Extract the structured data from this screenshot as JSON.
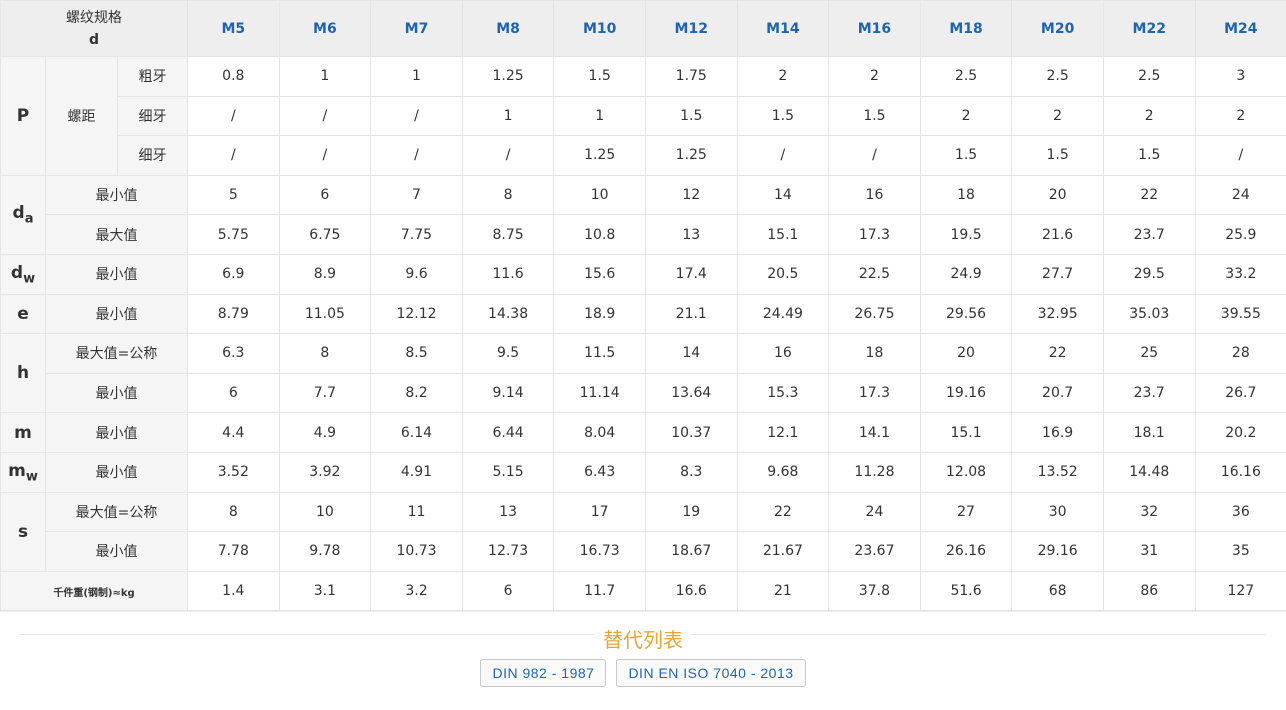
{
  "header": {
    "corner_line1": "螺纹规格",
    "corner_line2": "d",
    "sizes": [
      "M5",
      "M6",
      "M7",
      "M8",
      "M10",
      "M12",
      "M14",
      "M16",
      "M18",
      "M20",
      "M22",
      "M24"
    ]
  },
  "rows": {
    "P": {
      "symbol": "P",
      "group_label": "螺距",
      "coarse": {
        "label": "粗牙",
        "values": [
          "0.8",
          "1",
          "1",
          "1.25",
          "1.5",
          "1.75",
          "2",
          "2",
          "2.5",
          "2.5",
          "2.5",
          "3"
        ]
      },
      "fine1": {
        "label": "细牙",
        "values": [
          "/",
          "/",
          "/",
          "1",
          "1",
          "1.5",
          "1.5",
          "1.5",
          "2",
          "2",
          "2",
          "2"
        ]
      },
      "fine2": {
        "label": "细牙",
        "values": [
          "/",
          "/",
          "/",
          "/",
          "1.25",
          "1.25",
          "/",
          "/",
          "1.5",
          "1.5",
          "1.5",
          "/"
        ]
      }
    },
    "da": {
      "symbol": "d",
      "sub": "a",
      "min": {
        "label": "最小值",
        "values": [
          "5",
          "6",
          "7",
          "8",
          "10",
          "12",
          "14",
          "16",
          "18",
          "20",
          "22",
          "24"
        ]
      },
      "max": {
        "label": "最大值",
        "values": [
          "5.75",
          "6.75",
          "7.75",
          "8.75",
          "10.8",
          "13",
          "15.1",
          "17.3",
          "19.5",
          "21.6",
          "23.7",
          "25.9"
        ]
      }
    },
    "dw": {
      "symbol": "d",
      "sub": "w",
      "min": {
        "label": "最小值",
        "values": [
          "6.9",
          "8.9",
          "9.6",
          "11.6",
          "15.6",
          "17.4",
          "20.5",
          "22.5",
          "24.9",
          "27.7",
          "29.5",
          "33.2"
        ]
      }
    },
    "e": {
      "symbol": "e",
      "min": {
        "label": "最小值",
        "values": [
          "8.79",
          "11.05",
          "12.12",
          "14.38",
          "18.9",
          "21.1",
          "24.49",
          "26.75",
          "29.56",
          "32.95",
          "35.03",
          "39.55"
        ]
      }
    },
    "h": {
      "symbol": "h",
      "max": {
        "label": "最大值=公称",
        "values": [
          "6.3",
          "8",
          "8.5",
          "9.5",
          "11.5",
          "14",
          "16",
          "18",
          "20",
          "22",
          "25",
          "28"
        ]
      },
      "min": {
        "label": "最小值",
        "values": [
          "6",
          "7.7",
          "8.2",
          "9.14",
          "11.14",
          "13.64",
          "15.3",
          "17.3",
          "19.16",
          "20.7",
          "23.7",
          "26.7"
        ]
      }
    },
    "m": {
      "symbol": "m",
      "min": {
        "label": "最小值",
        "values": [
          "4.4",
          "4.9",
          "6.14",
          "6.44",
          "8.04",
          "10.37",
          "12.1",
          "14.1",
          "15.1",
          "16.9",
          "18.1",
          "20.2"
        ]
      }
    },
    "mw": {
      "symbol": "m",
      "sub": "w",
      "min": {
        "label": "最小值",
        "values": [
          "3.52",
          "3.92",
          "4.91",
          "5.15",
          "6.43",
          "8.3",
          "9.68",
          "11.28",
          "12.08",
          "13.52",
          "14.48",
          "16.16"
        ]
      }
    },
    "s": {
      "symbol": "s",
      "max": {
        "label": "最大值=公称",
        "values": [
          "8",
          "10",
          "11",
          "13",
          "17",
          "19",
          "22",
          "24",
          "27",
          "30",
          "32",
          "36"
        ]
      },
      "min": {
        "label": "最小值",
        "values": [
          "7.78",
          "9.78",
          "10.73",
          "12.73",
          "16.73",
          "18.67",
          "21.67",
          "23.67",
          "26.16",
          "29.16",
          "31",
          "35"
        ]
      }
    },
    "weight": {
      "label": "千件重(钢制)≈kg",
      "values": [
        "1.4",
        "3.1",
        "3.2",
        "6",
        "11.7",
        "16.6",
        "21",
        "37.8",
        "51.6",
        "68",
        "86",
        "127"
      ]
    }
  },
  "alternatives": {
    "title": "替代列表",
    "items": [
      "DIN 982 - 1987",
      "DIN EN ISO 7040 - 2013"
    ]
  },
  "colors": {
    "size_header": "#1f63b1",
    "alt_title": "#e8a435",
    "label_bg": "#f5f5f5",
    "header_bg": "#eeeeee"
  }
}
